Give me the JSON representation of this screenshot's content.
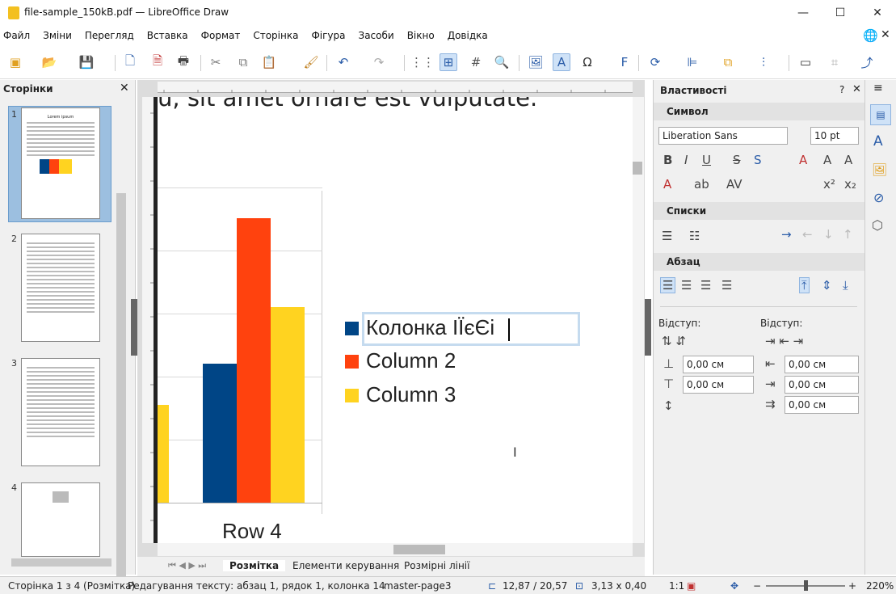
{
  "window": {
    "title": "file-sample_150kB.pdf — LibreOffice Draw"
  },
  "menu": [
    "Файл",
    "Зміни",
    "Перегляд",
    "Вставка",
    "Формат",
    "Сторінка",
    "Фігура",
    "Засоби",
    "Вікно",
    "Довідка"
  ],
  "pages_pane": {
    "title": "Сторінки",
    "page_numbers": [
      "1",
      "2",
      "3",
      "4"
    ],
    "thumb1_title": "Lorem ipsum"
  },
  "document": {
    "visible_heading": "u, sit amet ornare est vulputate.",
    "legend": [
      "Колонка ІЇєЄі",
      "Column 2",
      "Column 3"
    ],
    "row_label": "Row 4"
  },
  "chart_data": {
    "type": "bar",
    "categories": [
      "Row 4"
    ],
    "series": [
      {
        "name": "Колонка ІЇєЄі",
        "color": "#004586",
        "values": [
          4.4
        ]
      },
      {
        "name": "Column 2",
        "color": "#ff420e",
        "values": [
          9.02
        ]
      },
      {
        "name": "Column 3",
        "color": "#ffd320",
        "values": [
          6.2
        ]
      }
    ],
    "ylim": [
      0,
      10
    ],
    "legend_position": "right"
  },
  "tabs": [
    "Розмітка",
    "Елементи керування",
    "Розмірні лінії"
  ],
  "sidebar": {
    "title": "Властивості",
    "char_section": "Символ",
    "font_name": "Liberation Sans",
    "font_size": "10 pt",
    "lists_section": "Списки",
    "para_section": "Абзац",
    "indent_label_left": "Відступ:",
    "indent_label_right": "Відступ:",
    "spacing_above": "0,00 см",
    "spacing_below": "0,00 см",
    "indent_before": "0,00 см",
    "indent_after": "0,00 см",
    "indent_first": "0,00 см"
  },
  "status": {
    "page": "Сторінка 1 з 4 (Розмітка)",
    "edit": "Редагування тексту: абзац  1, рядок 1, колонка 14",
    "master": "master-page3",
    "position": "12,87 / 20,57",
    "size": "3,13 x 0,40",
    "scale": "1:1",
    "zoom": "220%"
  },
  "colors": {
    "accent": "#2a5ca8",
    "selection": "#9cbfe0"
  }
}
